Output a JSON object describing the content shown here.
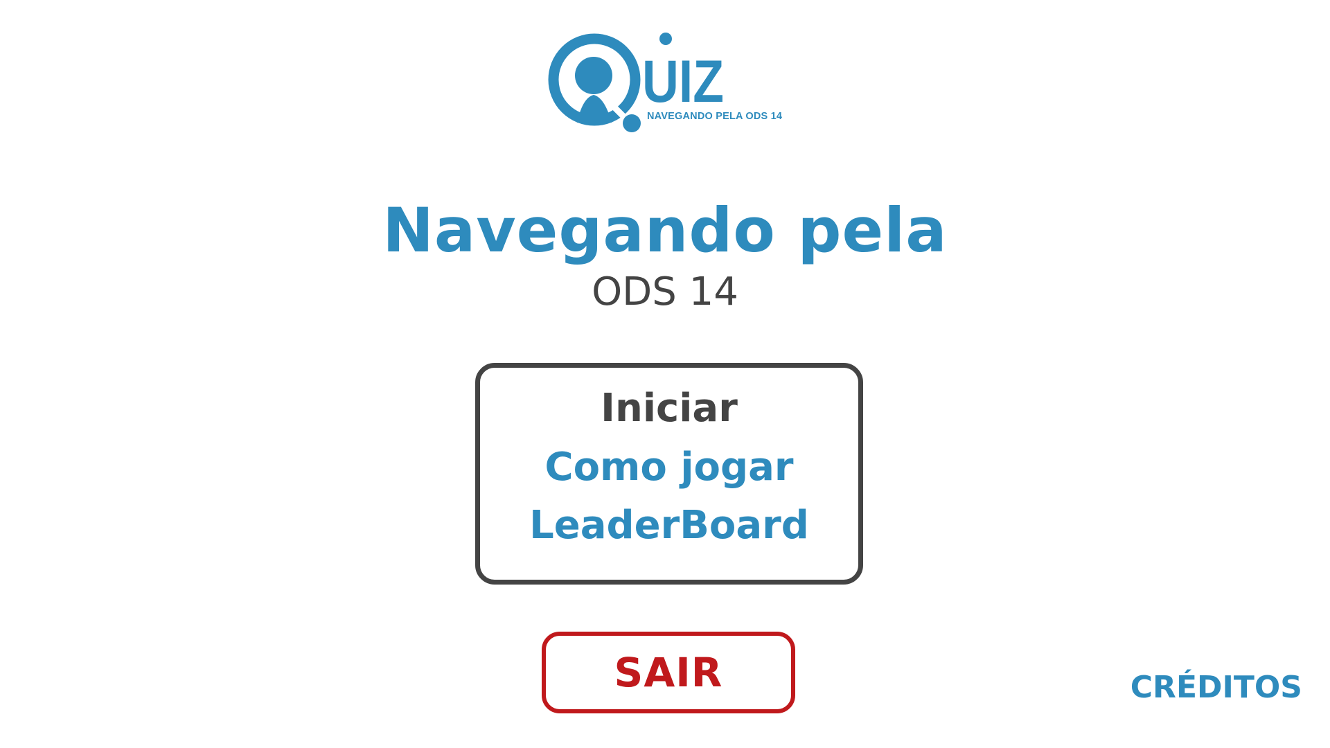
{
  "logo": {
    "text": "UIZ",
    "subtitle": "NAVEGANDO PELA ODS 14"
  },
  "title": {
    "main": "Navegando pela",
    "sub": "ODS 14"
  },
  "menu": {
    "start_label": "Iniciar",
    "howto_label": "Como jogar",
    "leaderboard_label": "LeaderBoard"
  },
  "exit_label": "SAIR",
  "credits_label": "CRÉDITOS",
  "colors": {
    "primary_blue": "#2e8bbd",
    "dark_gray": "#444444",
    "exit_red": "#c0191c",
    "background": "#ffffff"
  },
  "icons": {
    "logo_mark": "quiz-person-magnifier-icon"
  }
}
